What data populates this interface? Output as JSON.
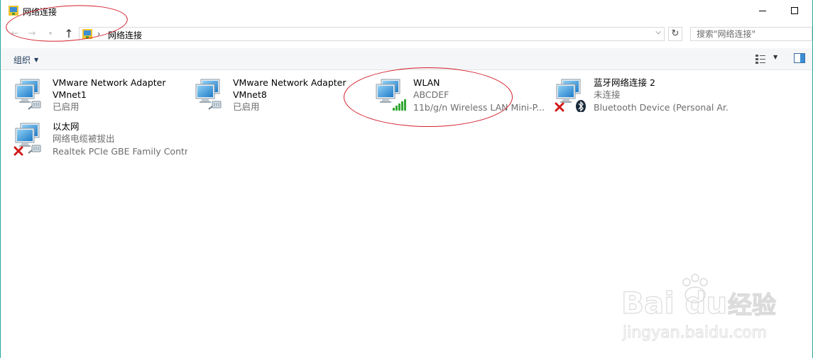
{
  "window": {
    "title": "网络连接"
  },
  "address_bar": {
    "path": "网络连接",
    "search_placeholder": "搜索\"网络连接\""
  },
  "command_bar": {
    "organize_label": "组织"
  },
  "items": [
    {
      "name": "VMware Network Adapter",
      "name2": "VMnet1",
      "status": "已启用",
      "device": ""
    },
    {
      "name": "VMware Network Adapter",
      "name2": "VMnet8",
      "status": "已启用",
      "device": ""
    },
    {
      "name": "WLAN",
      "name2": "",
      "status": "ABCDEF",
      "device": "11b/g/n   Wireless LAN Mini-P..."
    },
    {
      "name": "蓝牙网络连接 2",
      "name2": "",
      "status": "未连接",
      "device": "Bluetooth Device (Personal Ar..."
    },
    {
      "name": "以太网",
      "name2": "",
      "status": "网络电缆被拔出",
      "device": "Realtek PCIe GBE Family Contr..."
    }
  ],
  "watermark": {
    "brand": "Bai du",
    "brand_cn": "经验",
    "url": "jingyan.baidu.com"
  },
  "colors": {
    "accent": "#2aa7a0",
    "annotation": "#d21f2a",
    "secondary_text": "#6d6d6d"
  },
  "icons": [
    "network-connection-icon",
    "back-arrow-icon",
    "forward-arrow-icon",
    "up-arrow-icon",
    "refresh-icon",
    "view-options-icon",
    "preview-pane-icon",
    "disconnected-x-icon",
    "bluetooth-icon",
    "wifi-signal-icon"
  ]
}
